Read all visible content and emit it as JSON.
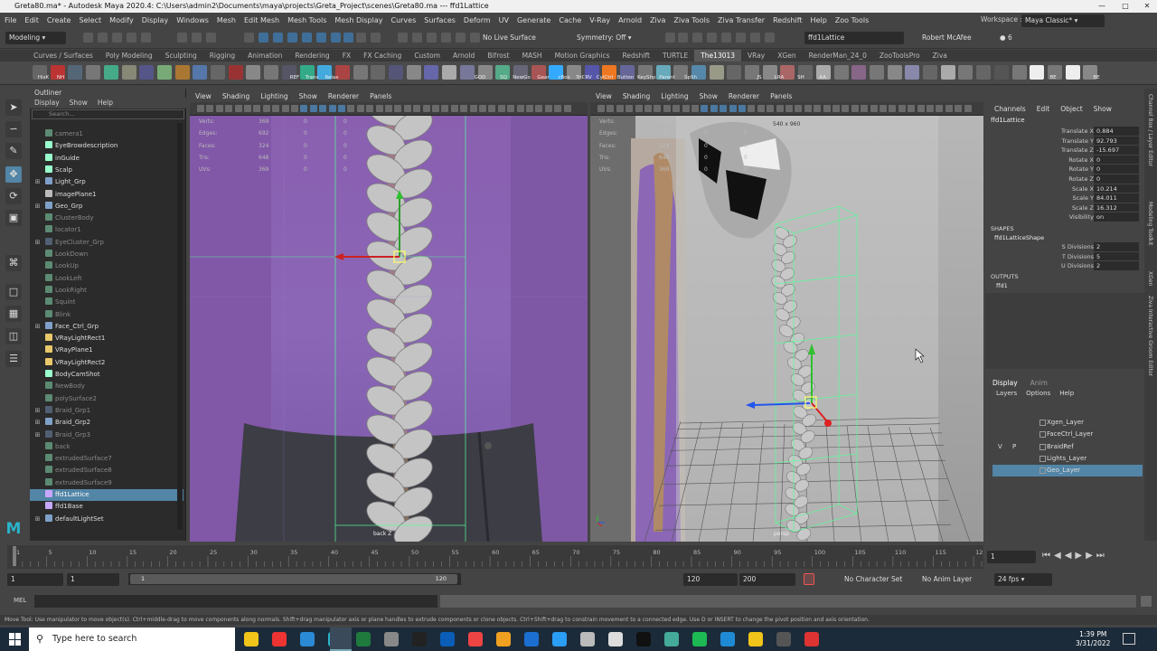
{
  "window": {
    "title": "Greta80.ma* - Autodesk Maya 2020.4: C:\\Users\\admin2\\Documents\\maya\\projects\\Greta_Project\\scenes\\Greta80.ma   ---   ffd1Lattice"
  },
  "menu": [
    "File",
    "Edit",
    "Create",
    "Select",
    "Modify",
    "Display",
    "Windows",
    "Mesh",
    "Edit Mesh",
    "Mesh Tools",
    "Mesh Display",
    "Curves",
    "Surfaces",
    "Deform",
    "UV",
    "Generate",
    "Cache",
    "V-Ray",
    "Arnold",
    "Ziva",
    "Ziva Tools",
    "Ziva Transfer",
    "Redshift",
    "Help",
    "Zoo Tools"
  ],
  "workspace": {
    "label": "Workspace :",
    "value": "Maya Classic*"
  },
  "status": {
    "mode": "Modeling",
    "live_surface": "No Live Surface",
    "symmetry": "Symmetry: Off",
    "object_field": "ffd1Lattice",
    "user": "Robert McAfee",
    "badge": "6"
  },
  "shelf_tabs": [
    "Curves / Surfaces",
    "Poly Modeling",
    "Sculpting",
    "Rigging",
    "Animation",
    "Rendering",
    "FX",
    "FX Caching",
    "Custom",
    "Arnold",
    "Bifrost",
    "MASH",
    "Motion Graphics",
    "Redshift",
    "TURTLE",
    "The13013",
    "VRay",
    "XGen",
    "RenderMan_24_0",
    "ZooToolsPro",
    "Ziva"
  ],
  "shelf_active": "The13013",
  "shelf_labels": [
    "HisK",
    "NH",
    "REF",
    "Trans",
    "Relax",
    "GOD",
    "SQ",
    "NewGo",
    "Gear",
    "cBox",
    "TriCRV",
    "CylCtrl",
    "Button",
    "KeyShp",
    "Parent",
    "SpSh",
    "JS",
    "LRA",
    "SH",
    "AA",
    "BE",
    "PHN",
    "BE"
  ],
  "outliner": {
    "title": "Outliner",
    "menu": [
      "Display",
      "Show",
      "Help"
    ],
    "search_placeholder": "Search...",
    "items": [
      {
        "label": "camera1",
        "dim": true,
        "exp": false
      },
      {
        "label": "EyeBrowdescription",
        "dim": false,
        "exp": false
      },
      {
        "label": "inGuide",
        "dim": false,
        "exp": false
      },
      {
        "label": "Scalp",
        "dim": false,
        "exp": false
      },
      {
        "label": "Light_Grp",
        "dim": false,
        "exp": true
      },
      {
        "label": "imagePlane1",
        "dim": false,
        "exp": false
      },
      {
        "label": "Geo_Grp",
        "dim": false,
        "exp": true
      },
      {
        "label": "ClusterBody",
        "dim": true,
        "exp": false
      },
      {
        "label": "locator1",
        "dim": true,
        "exp": false
      },
      {
        "label": "EyeCluster_Grp",
        "dim": true,
        "exp": true
      },
      {
        "label": "LookDown",
        "dim": true,
        "exp": false
      },
      {
        "label": "LookUp",
        "dim": true,
        "exp": false
      },
      {
        "label": "LookLeft",
        "dim": true,
        "exp": false
      },
      {
        "label": "LookRight",
        "dim": true,
        "exp": false
      },
      {
        "label": "Squint",
        "dim": true,
        "exp": false
      },
      {
        "label": "Blink",
        "dim": true,
        "exp": false
      },
      {
        "label": "Face_Ctrl_Grp",
        "dim": false,
        "exp": true
      },
      {
        "label": "VRayLightRect1",
        "dim": false,
        "exp": false
      },
      {
        "label": "VRayPlane1",
        "dim": false,
        "exp": false
      },
      {
        "label": "VRayLightRect2",
        "dim": false,
        "exp": false
      },
      {
        "label": "BodyCamShot",
        "dim": false,
        "exp": false
      },
      {
        "label": "NewBody",
        "dim": true,
        "exp": false
      },
      {
        "label": "polySurface2",
        "dim": true,
        "exp": false
      },
      {
        "label": "Braid_Grp1",
        "dim": true,
        "exp": true
      },
      {
        "label": "Braid_Grp2",
        "dim": false,
        "exp": true
      },
      {
        "label": "Braid_Grp3",
        "dim": true,
        "exp": true
      },
      {
        "label": "back",
        "dim": true,
        "exp": false
      },
      {
        "label": "extrudedSurface7",
        "dim": true,
        "exp": false
      },
      {
        "label": "extrudedSurface8",
        "dim": true,
        "exp": false
      },
      {
        "label": "extrudedSurface9",
        "dim": true,
        "exp": false
      },
      {
        "label": "ffd1Lattice",
        "dim": false,
        "exp": false,
        "sel": true
      },
      {
        "label": "ffd1Base",
        "dim": false,
        "exp": false
      },
      {
        "label": "defaultLightSet",
        "dim": false,
        "exp": true
      }
    ]
  },
  "viewport_menu": [
    "View",
    "Shading",
    "Lighting",
    "Show",
    "Renderer",
    "Panels"
  ],
  "hud": {
    "keys": [
      "Verts:",
      "Edges:",
      "Faces:",
      "Tris:",
      "UVs:"
    ],
    "col1": [
      "369",
      "692",
      "324",
      "648",
      "369"
    ],
    "col2": [
      "0",
      "0",
      "0",
      "0",
      "0"
    ],
    "col3": [
      "0",
      "0",
      "0",
      "0",
      "0"
    ]
  },
  "viewport_left": {
    "camera": "back Z"
  },
  "viewport_right": {
    "camera": "persp",
    "resolution": "540 x 960"
  },
  "channel_box": {
    "menu": [
      "Channels",
      "Edit",
      "Object",
      "Show"
    ],
    "object": "ffd1Lattice",
    "attrs": [
      {
        "k": "Translate X",
        "v": "0.884"
      },
      {
        "k": "Translate Y",
        "v": "92.793"
      },
      {
        "k": "Translate Z",
        "v": "-15.697"
      },
      {
        "k": "Rotate X",
        "v": "0"
      },
      {
        "k": "Rotate Y",
        "v": "0"
      },
      {
        "k": "Rotate Z",
        "v": "0"
      },
      {
        "k": "Scale X",
        "v": "10.214"
      },
      {
        "k": "Scale Y",
        "v": "84.011"
      },
      {
        "k": "Scale Z",
        "v": "16.312"
      },
      {
        "k": "Visibility",
        "v": "on"
      }
    ],
    "shapes_header": "SHAPES",
    "shape_name": "ffd1LatticeShape",
    "shape_attrs": [
      {
        "k": "S Divisions",
        "v": "2"
      },
      {
        "k": "T Divisions",
        "v": "5"
      },
      {
        "k": "U Divisions",
        "v": "2"
      }
    ],
    "outputs_header": "OUTPUTS",
    "output_name": "ffd1"
  },
  "side_tabs": [
    "Channel Box / Layer Editor",
    "Modeling Toolkit",
    "XGen",
    "Ziva Interactive Groom Editor"
  ],
  "layers": {
    "tabs": [
      "Display",
      "Anim"
    ],
    "menu": [
      "Layers",
      "Options",
      "Help"
    ],
    "items": [
      {
        "v": "",
        "p": "",
        "name": "Xgen_Layer"
      },
      {
        "v": "",
        "p": "",
        "name": "FaceCtrl_Layer"
      },
      {
        "v": "V",
        "p": "P",
        "name": "BraidRef"
      },
      {
        "v": "",
        "p": "",
        "name": "Lights_Layer"
      },
      {
        "v": "",
        "p": "",
        "name": "Geo_Layer",
        "sel": true
      }
    ]
  },
  "timeline": {
    "ticks": [
      "1",
      "5",
      "10",
      "15",
      "20",
      "25",
      "30",
      "35",
      "40",
      "45",
      "50",
      "55",
      "60",
      "65",
      "70",
      "75",
      "80",
      "85",
      "90",
      "95",
      "100",
      "105",
      "110",
      "115",
      "12"
    ],
    "current": "1"
  },
  "range": {
    "start": "1",
    "inner_start": "1",
    "slider_start": "1",
    "slider_end": "120",
    "end": "120",
    "outer_end": "200",
    "char_set": "No Character Set",
    "anim_layer": "No Anim Layer",
    "fps": "24 fps"
  },
  "cmd": {
    "label": "MEL"
  },
  "help_text": "Move Tool: Use manipulator to move object(s). Ctrl+middle-drag to move components along normals. Shift+drag manipulator axis or plane handles to extrude components or clone objects. Ctrl+Shift+drag to constrain movement to a connected edge. Use D or INSERT to change the pivot position and axis orientation.",
  "taskbar": {
    "search_placeholder": "Type here to search",
    "time": "1:39 PM",
    "date": "3/31/2022"
  },
  "colors": {
    "accent": "#5285a6",
    "lattice": "#4dff88",
    "ui_bg": "#444444",
    "field_bg": "#2b2b2b"
  }
}
